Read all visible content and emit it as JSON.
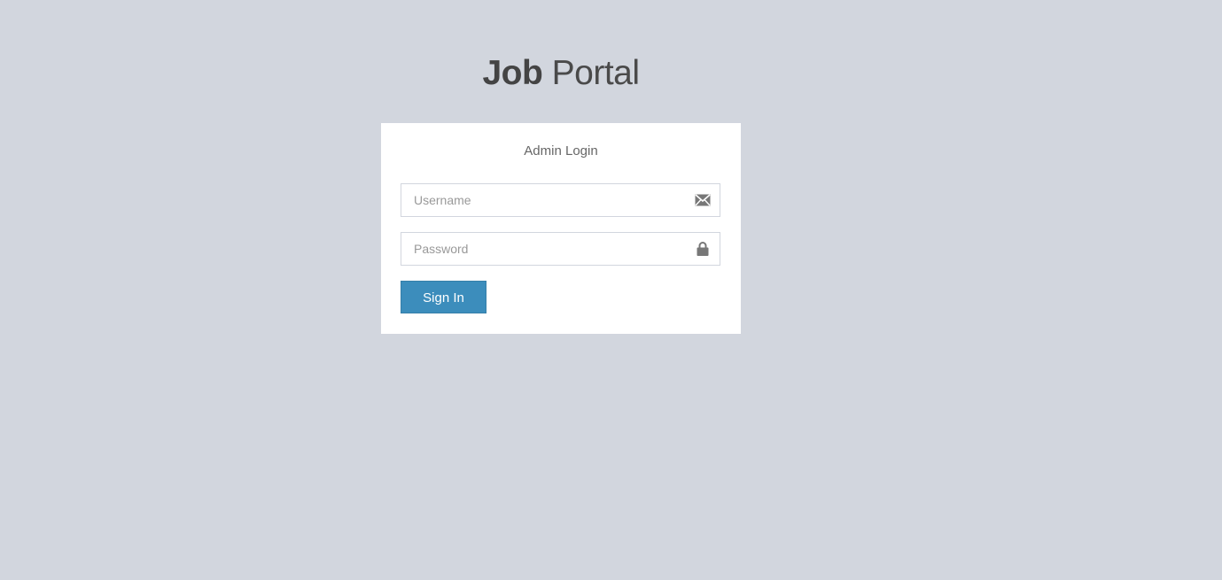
{
  "logo": {
    "bold": "Job",
    "light": " Portal"
  },
  "login": {
    "message": "Admin Login",
    "username": {
      "value": "",
      "placeholder": "Username",
      "icon": "envelope-icon"
    },
    "password": {
      "value": "",
      "placeholder": "Password",
      "icon": "lock-icon"
    },
    "submit_label": "Sign In"
  },
  "colors": {
    "background": "#d2d6de",
    "button": "#3c8dbc",
    "icon": "#777777"
  }
}
